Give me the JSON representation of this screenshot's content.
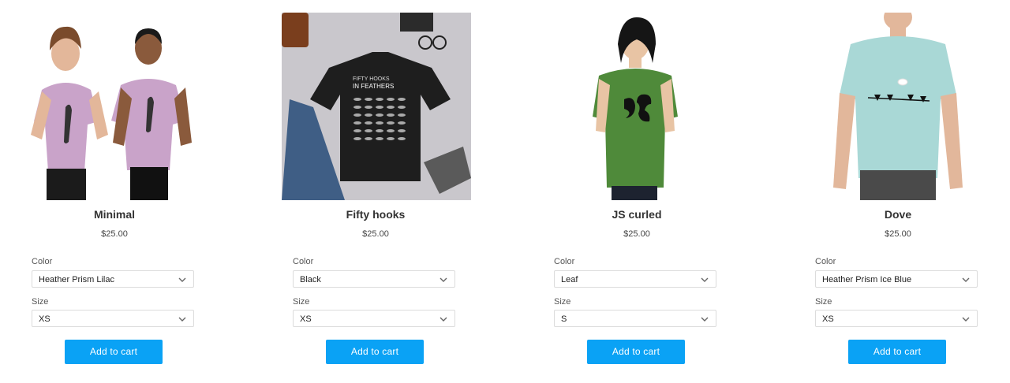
{
  "labels": {
    "color": "Color",
    "size": "Size",
    "add_to_cart": "Add to cart"
  },
  "products": [
    {
      "title": "Minimal",
      "price": "$25.00",
      "color": "Heather Prism Lilac",
      "size": "XS"
    },
    {
      "title": "Fifty hooks",
      "price": "$25.00",
      "color": "Black",
      "size": "XS",
      "shirt_print": {
        "line1": "FIFTY HOOKS",
        "line2": "IN FEATHERS"
      }
    },
    {
      "title": "JS curled",
      "price": "$25.00",
      "color": "Leaf",
      "size": "S"
    },
    {
      "title": "Dove",
      "price": "$25.00",
      "color": "Heather Prism Ice Blue",
      "size": "XS"
    }
  ],
  "colors": {
    "button": "#0aa2f5",
    "lilac": "#c9a3c9",
    "black_tee": "#1e1e1e",
    "leaf": "#4f8a3a",
    "ice_blue": "#a9d8d6"
  },
  "icons": {
    "chevron": "chevron-down-icon"
  }
}
